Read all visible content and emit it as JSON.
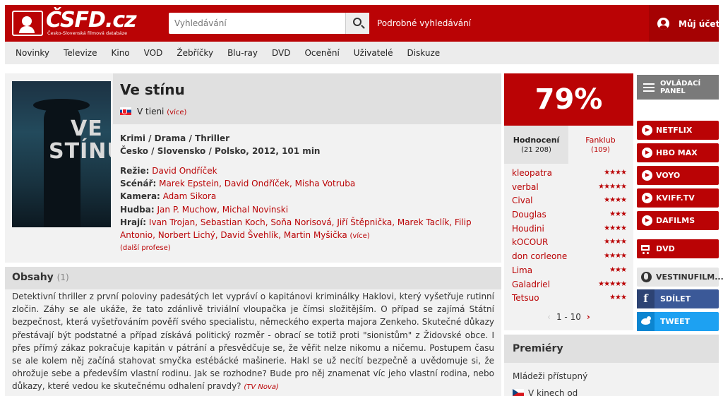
{
  "header": {
    "logo_text": "ČSFD.cz",
    "logo_subtitle": "Česko-Slovenská filmová databáze",
    "search_placeholder": "Vyhledávání",
    "advanced_search": "Podrobné vyhledávání",
    "user_label": "Můj účet"
  },
  "nav": {
    "items": [
      "Novinky",
      "Televize",
      "Kino",
      "VOD",
      "Žebříčky",
      "Blu-ray",
      "DVD",
      "Ocenění",
      "Uživatelé",
      "Diskuze"
    ]
  },
  "movie": {
    "title": "Ve stínu",
    "poster_text": "VE STÍNU",
    "alt_title": "V tieni",
    "alt_more": "(více)",
    "genres": "Krimi / Drama / Thriller",
    "origin": "Česko / Slovensko / Polsko, 2012, 101 min",
    "director_label": "Režie:",
    "director": "David Ondříček",
    "writers_label": "Scénář:",
    "writers": "Marek Epstein, David Ondříček, Misha Votruba",
    "camera_label": "Kamera:",
    "camera": "Adam Sikora",
    "music_label": "Hudba:",
    "music": "Jan P. Muchow, Michal Novinski",
    "cast_label": "Hrají:",
    "cast": "Ivan Trojan, Sebastian Koch, Soňa Norisová, Jiří Štěpnička, Marek Taclík, Filip Antonio, Norbert Lichý, David Švehlík, Martin Myšička",
    "cast_more": "(více)",
    "more_creators": "(další profese)"
  },
  "plot": {
    "title": "Obsahy",
    "count": "(1)",
    "text": "Detektivní thriller z první poloviny padesátých let vypráví o kapitánovi kriminálky Haklovi, který vyšetřuje rutinní zločin. Záhy se ale ukáže, že tato zdánlivě triviální vloupačka je čímsi složitějším. O případ se zajímá Státní bezpečnost, která vyšetřováním pověří svého specialistu, německého experta majora Zenkeho. Skutečné důkazy přestávají být podstatné a případ získává politický rozměr - obrací se totiž proti \"sionistům\" z Židovské obce. I přes přímý zákaz pokračuje kapitán v pátrání a přesvědčuje se, že věřit nelze nikomu a ničemu. Postupem času se ale kolem něj začíná stahovat smyčka estébácké mašinerie. Hakl se už necítí bezpečně a uvědomuje si, že ohrožuje sebe a především vlastní rodinu. Jak se rozhodne? Bude pro něj znamenat víc jeho vlastní rodina, nebo důkazy, které vedou ke skutečnému odhalení pravdy?",
    "source": "(TV Nova)"
  },
  "rating": {
    "percent": "79%",
    "tabs": [
      {
        "label": "Hodnocení",
        "count": "(21 208)"
      },
      {
        "label": "Fanklub",
        "count": "(109)"
      }
    ],
    "users": [
      {
        "name": "kleopatra",
        "stars": "★★★★"
      },
      {
        "name": "verbal",
        "stars": "★★★★★"
      },
      {
        "name": "Cival",
        "stars": "★★★★"
      },
      {
        "name": "Douglas",
        "stars": "★★★"
      },
      {
        "name": "Houdini",
        "stars": "★★★★"
      },
      {
        "name": "kOCOUR",
        "stars": "★★★★"
      },
      {
        "name": "don corleone",
        "stars": "★★★★"
      },
      {
        "name": "Lima",
        "stars": "★★★"
      },
      {
        "name": "Galadriel",
        "stars": "★★★★★"
      },
      {
        "name": "Tetsuo",
        "stars": "★★★"
      }
    ],
    "pager": "1 - 10"
  },
  "sidebar": {
    "control_panel": "OVLÁDACÍ PANEL",
    "services": [
      "NETFLIX",
      "HBO MAX",
      "VOYO",
      "KVIFF.TV",
      "DAFILMS"
    ],
    "dvd": "DVD",
    "external": "VESTINUFILM...",
    "share": "SDÍLET",
    "tweet": "TWEET"
  },
  "premieres": {
    "title": "Premiéry",
    "rating_label": "Mládeži přístupný",
    "cinema_label": "V kinech od"
  },
  "colors": {
    "brand_red": "#ba0305",
    "facebook": "#3b5998",
    "twitter": "#1da1f2"
  }
}
